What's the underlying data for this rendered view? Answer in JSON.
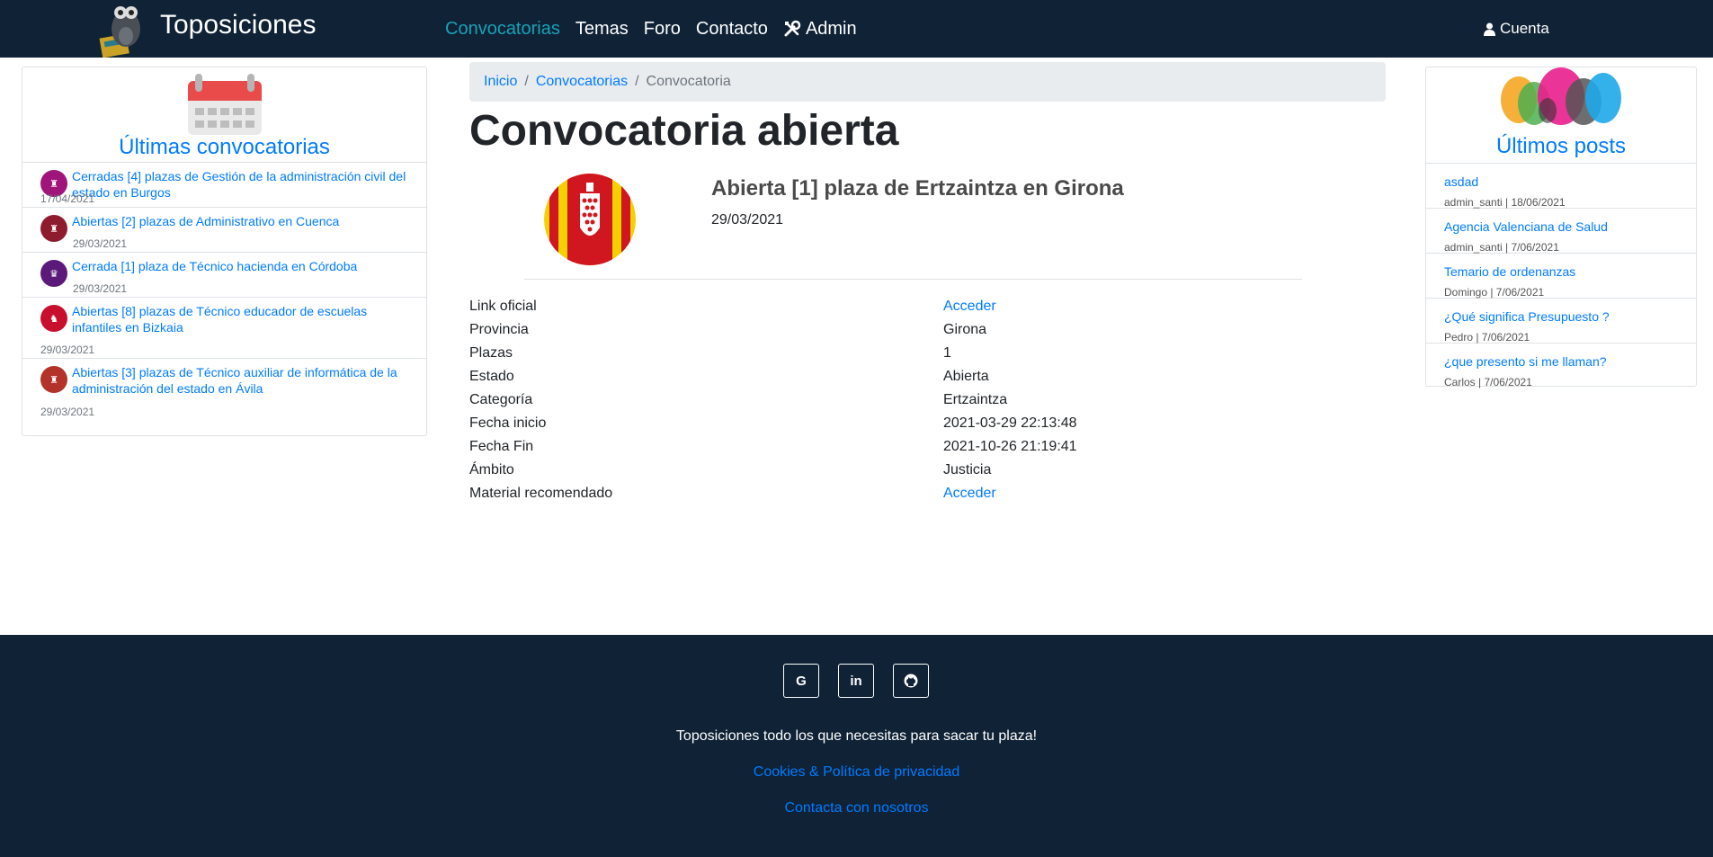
{
  "navbar": {
    "brand": "Toposiciones",
    "links": [
      "Convocatorias",
      "Temas",
      "Foro",
      "Contacto",
      "Admin"
    ],
    "account": "Cuenta"
  },
  "left_sidebar": {
    "title": "Últimas convocatorias",
    "items": [
      {
        "label": "Cerradas [4] plazas de Gestión de la administración civil del estado en Burgos",
        "date": "17/04/2021",
        "color": "#a0157a"
      },
      {
        "label": "Abiertas [2] plazas de Administrativo en Cuenca",
        "date": "29/03/2021",
        "color": "#8e1b2e"
      },
      {
        "label": "Cerrada [1] plaza de Técnico hacienda en Córdoba",
        "date": "29/03/2021",
        "color": "#5b1a7a"
      },
      {
        "label": "Abiertas [8] plazas de Técnico educador de escuelas infantiles en Bizkaia",
        "date": "29/03/2021",
        "color": "#c8102e"
      },
      {
        "label": "Abiertas [3] plazas de Técnico auxiliar de informática de la administración del estado en Ávila",
        "date": "29/03/2021",
        "color": "#b3322a"
      }
    ]
  },
  "breadcrumb": {
    "home": "Inicio",
    "section": "Convocatorias",
    "current": "Convocatoria"
  },
  "main": {
    "page_title": "Convocatoria abierta",
    "conv_title": "Abierta [1] plaza de Ertzaintza en Girona",
    "conv_date": "29/03/2021",
    "details": [
      {
        "label": "Link oficial",
        "value": "Acceder",
        "link": true
      },
      {
        "label": "Provincia",
        "value": "Girona",
        "link": false
      },
      {
        "label": "Plazas",
        "value": "1",
        "link": false
      },
      {
        "label": "Estado",
        "value": "Abierta",
        "link": false
      },
      {
        "label": "Categoría",
        "value": "Ertzaintza",
        "link": false
      },
      {
        "label": "Fecha inicio",
        "value": "2021-03-29 22:13:48",
        "link": false
      },
      {
        "label": "Fecha Fin",
        "value": "2021-10-26 21:19:41",
        "link": false
      },
      {
        "label": "Ámbito",
        "value": "Justicia",
        "link": false
      },
      {
        "label": "Material recomendado",
        "value": "Acceder",
        "link": true
      }
    ]
  },
  "right_sidebar": {
    "title": "Últimos posts",
    "posts": [
      {
        "title": "asdad",
        "meta": "admin_santi | 18/06/2021"
      },
      {
        "title": "Agencia Valenciana de Salud",
        "meta": "admin_santi | 7/06/2021"
      },
      {
        "title": "Temario de ordenanzas",
        "meta": "Domingo | 7/06/2021"
      },
      {
        "title": "¿Qué significa Presupuesto ?",
        "meta": "Pedro | 7/06/2021"
      },
      {
        "title": "¿que presento si me llaman?",
        "meta": "Carlos | 7/06/2021"
      }
    ]
  },
  "footer": {
    "social_icons": [
      "google-icon",
      "linkedin-icon",
      "github-icon"
    ],
    "tagline": "Toposiciones todo los que necesitas para sacar tu plaza!",
    "cookies": "Cookies & Política de privacidad",
    "contact": "Contacta con nosotros"
  },
  "colors": {
    "navbar_bg": "#0f2236",
    "link": "#007bff",
    "active_nav": "#17a2b8"
  }
}
